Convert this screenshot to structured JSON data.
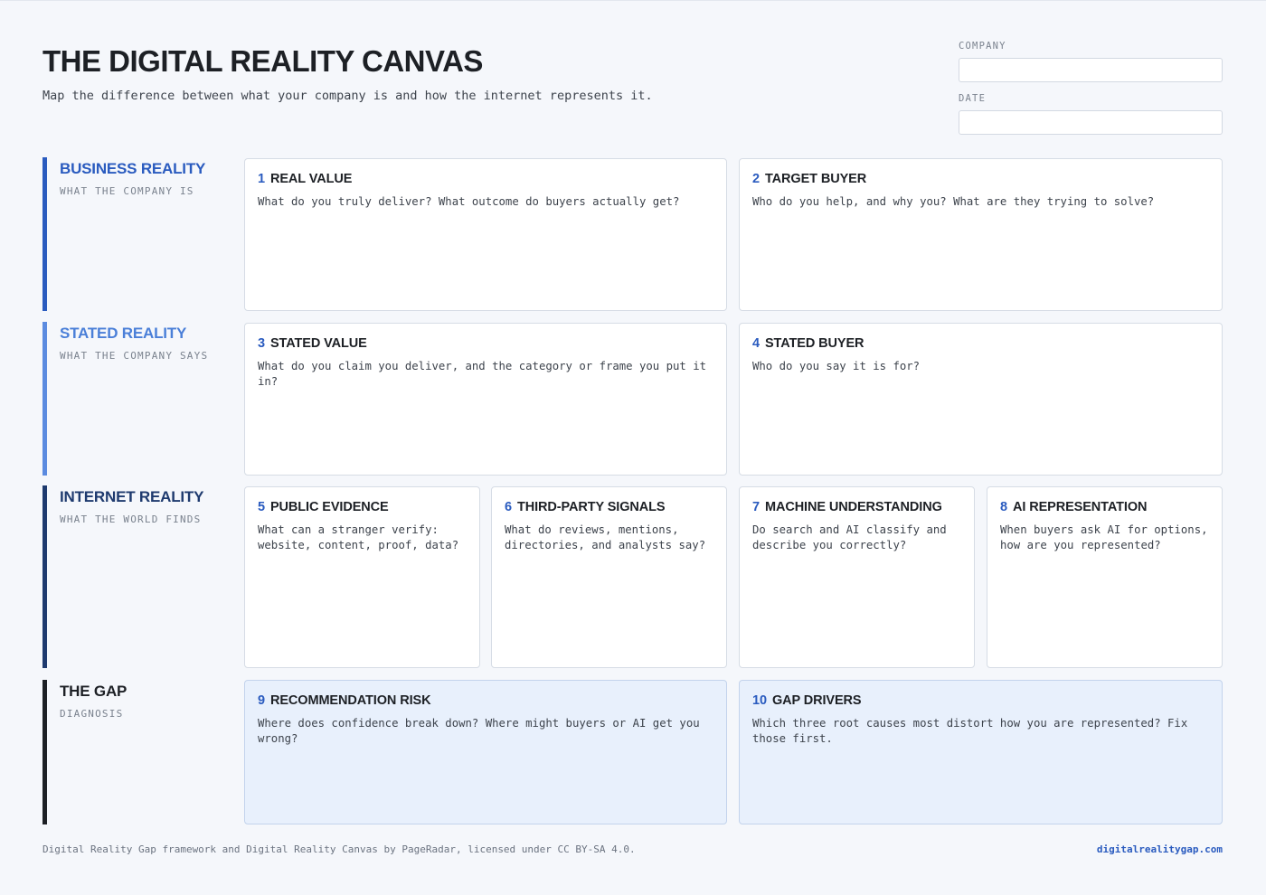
{
  "header": {
    "title": "THE DIGITAL REALITY CANVAS",
    "subtitle": "Map the difference between what your company is and how the internet represents it."
  },
  "fields": {
    "company_label": "COMPANY",
    "company_value": "",
    "date_label": "DATE",
    "date_value": ""
  },
  "colors": {
    "business": "#2a5bbf",
    "stated": "#5b8be0",
    "internet": "#1e3a6e",
    "gap": "#1d2025"
  },
  "sections": {
    "business": {
      "title": "BUSINESS REALITY",
      "sub": "WHAT THE COMPANY IS"
    },
    "stated": {
      "title": "STATED REALITY",
      "sub": "WHAT THE COMPANY SAYS"
    },
    "internet": {
      "title": "INTERNET REALITY",
      "sub": "WHAT THE WORLD FINDS"
    },
    "gap": {
      "title": "THE GAP",
      "sub": "DIAGNOSIS"
    }
  },
  "cards": [
    {
      "num": "1",
      "title": "REAL VALUE",
      "question": "What do you truly deliver? What outcome do buyers actually get?"
    },
    {
      "num": "2",
      "title": "TARGET BUYER",
      "question": "Who do you help, and why you? What are they trying to solve?"
    },
    {
      "num": "3",
      "title": "STATED VALUE",
      "question": "What do you claim you deliver, and the category or frame you put it in?"
    },
    {
      "num": "4",
      "title": "STATED BUYER",
      "question": "Who do you say it is for?"
    },
    {
      "num": "5",
      "title": "PUBLIC EVIDENCE",
      "question": "What can a stranger verify: website, content, proof, data?"
    },
    {
      "num": "6",
      "title": "THIRD-PARTY SIGNALS",
      "question": "What do reviews, mentions, directories, and analysts say?"
    },
    {
      "num": "7",
      "title": "MACHINE UNDERSTANDING",
      "question": "Do search and AI classify and describe you correctly?"
    },
    {
      "num": "8",
      "title": "AI REPRESENTATION",
      "question": "When buyers ask AI for options, how are you represented?"
    },
    {
      "num": "9",
      "title": "RECOMMENDATION RISK",
      "question": "Where does confidence break down? Where might buyers or AI get you wrong?"
    },
    {
      "num": "10",
      "title": "GAP DRIVERS",
      "question": "Which three root causes most distort how you are represented? Fix those first."
    }
  ],
  "footer": {
    "credit": "Digital Reality Gap framework and Digital Reality Canvas by PageRadar, licensed under CC BY-SA 4.0.",
    "link": "digitalrealitygap.com"
  }
}
